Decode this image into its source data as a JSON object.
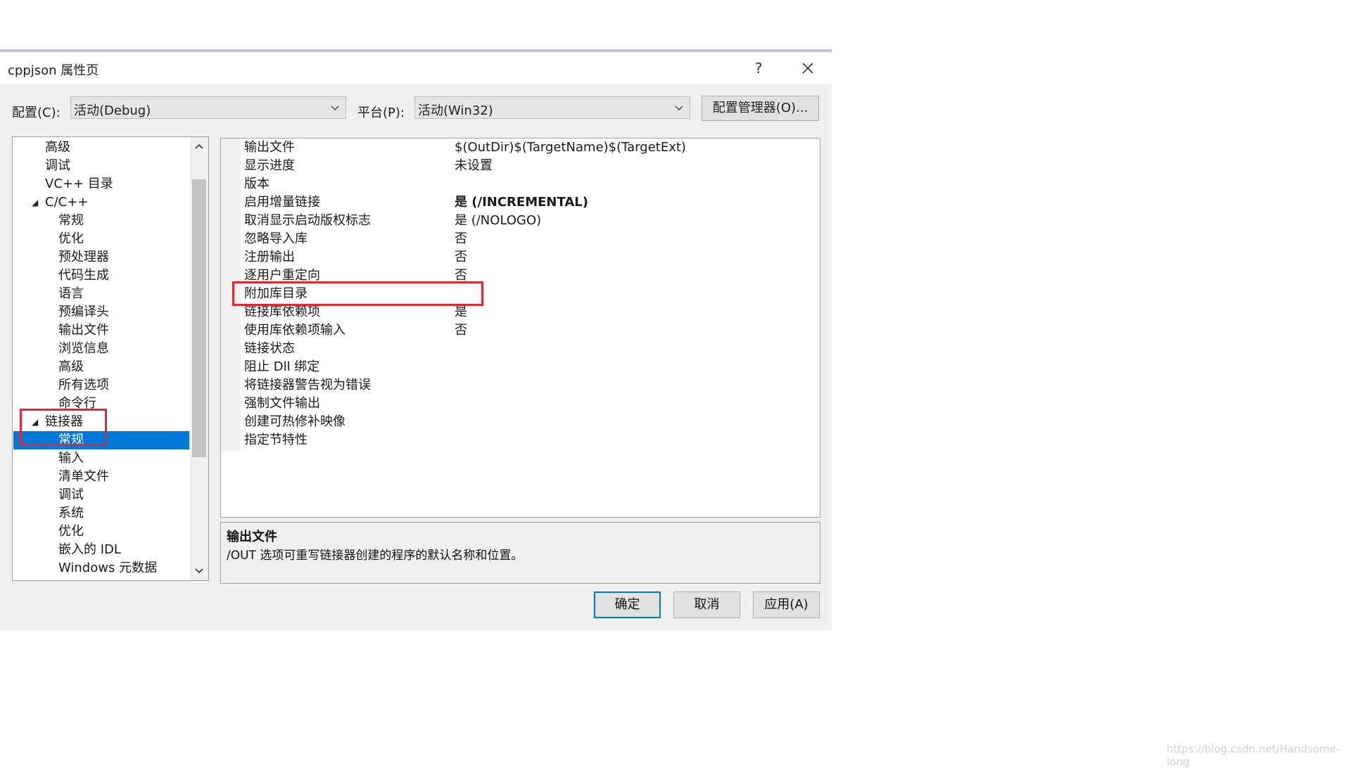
{
  "window": {
    "title": "cppjson 属性页",
    "help": "?"
  },
  "toolbar": {
    "config_label": "配置(C):",
    "config_value": "活动(Debug)",
    "platform_label": "平台(P):",
    "platform_value": "活动(Win32)",
    "manager_label": "配置管理器(O)..."
  },
  "tree": {
    "items": [
      {
        "label": "高级"
      },
      {
        "label": "调试"
      },
      {
        "label": "VC++ 目录"
      },
      {
        "label": "C/C++"
      },
      {
        "label": "常规"
      },
      {
        "label": "优化"
      },
      {
        "label": "预处理器"
      },
      {
        "label": "代码生成"
      },
      {
        "label": "语言"
      },
      {
        "label": "预编译头"
      },
      {
        "label": "输出文件"
      },
      {
        "label": "浏览信息"
      },
      {
        "label": "高级"
      },
      {
        "label": "所有选项"
      },
      {
        "label": "命令行"
      },
      {
        "label": "链接器"
      },
      {
        "label": "常规"
      },
      {
        "label": "输入"
      },
      {
        "label": "清单文件"
      },
      {
        "label": "调试"
      },
      {
        "label": "系统"
      },
      {
        "label": "优化"
      },
      {
        "label": "嵌入的 IDL"
      },
      {
        "label": "Windows 元数据"
      }
    ]
  },
  "properties": [
    {
      "name": "输出文件",
      "value": "$(OutDir)$(TargetName)$(TargetExt)"
    },
    {
      "name": "显示进度",
      "value": "未设置"
    },
    {
      "name": "版本",
      "value": ""
    },
    {
      "name": "启用增量链接",
      "value": "是 (/INCREMENTAL)"
    },
    {
      "name": "取消显示启动版权标志",
      "value": "是 (/NOLOGO)"
    },
    {
      "name": "忽略导入库",
      "value": "否"
    },
    {
      "name": "注册输出",
      "value": "否"
    },
    {
      "name": "逐用户重定向",
      "value": "否"
    },
    {
      "name": "附加库目录",
      "value": ""
    },
    {
      "name": "链接库依赖项",
      "value": "是"
    },
    {
      "name": "使用库依赖项输入",
      "value": "否"
    },
    {
      "name": "链接状态",
      "value": ""
    },
    {
      "name": "阻止 Dll 绑定",
      "value": ""
    },
    {
      "name": "将链接器警告视为错误",
      "value": ""
    },
    {
      "name": "强制文件输出",
      "value": ""
    },
    {
      "name": "创建可热修补映像",
      "value": ""
    },
    {
      "name": "指定节特性",
      "value": ""
    }
  ],
  "description": {
    "title": "输出文件",
    "text": "/OUT 选项可重写链接器创建的程序的默认名称和位置。"
  },
  "buttons": {
    "ok": "确定",
    "cancel": "取消",
    "apply": "应用(A)"
  },
  "watermark": "https://blog.csdn.net/Handsome-long",
  "colors": {
    "selection": "#0078d7",
    "highlight_box": "#e3262f"
  }
}
